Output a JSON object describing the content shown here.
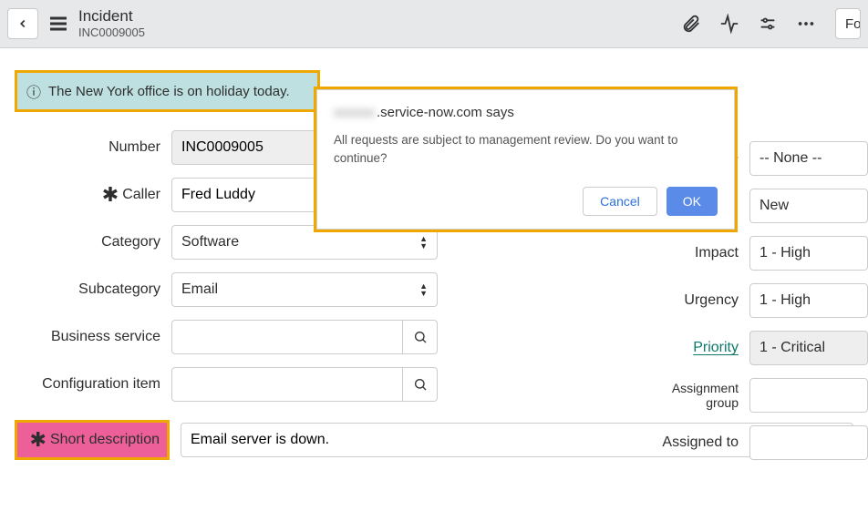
{
  "header": {
    "title": "Incident",
    "subtitle": "INC0009005"
  },
  "banner": {
    "text": "The New York office is on holiday today."
  },
  "dialog": {
    "domain_hidden": "xxxxxx",
    "domain_visible": ".service-now.com says",
    "message": "All requests are subject to management review.  Do you want to continue?",
    "cancel": "Cancel",
    "ok": "OK"
  },
  "labels": {
    "number": "Number",
    "caller": "Caller",
    "category": "Category",
    "subcategory": "Subcategory",
    "business_service": "Business service",
    "configuration_item": "Configuration item",
    "short_description": "Short description",
    "state_partial": "e",
    "impact": "Impact",
    "urgency": "Urgency",
    "priority": "Priority",
    "assignment_group": "Assignment group",
    "assigned_to": "Assigned to"
  },
  "fields": {
    "number": "INC0009005",
    "caller": "Fred Luddy",
    "category": "Software",
    "subcategory": "Email",
    "business_service": "",
    "configuration_item": "",
    "short_description": "Email server is down.",
    "none": "-- None --",
    "state": "New",
    "impact": "1 - High",
    "urgency": "1 - High",
    "priority": "1 - Critical",
    "assignment_group": "",
    "assigned_to": ""
  },
  "toolbar_fo": "Fo"
}
